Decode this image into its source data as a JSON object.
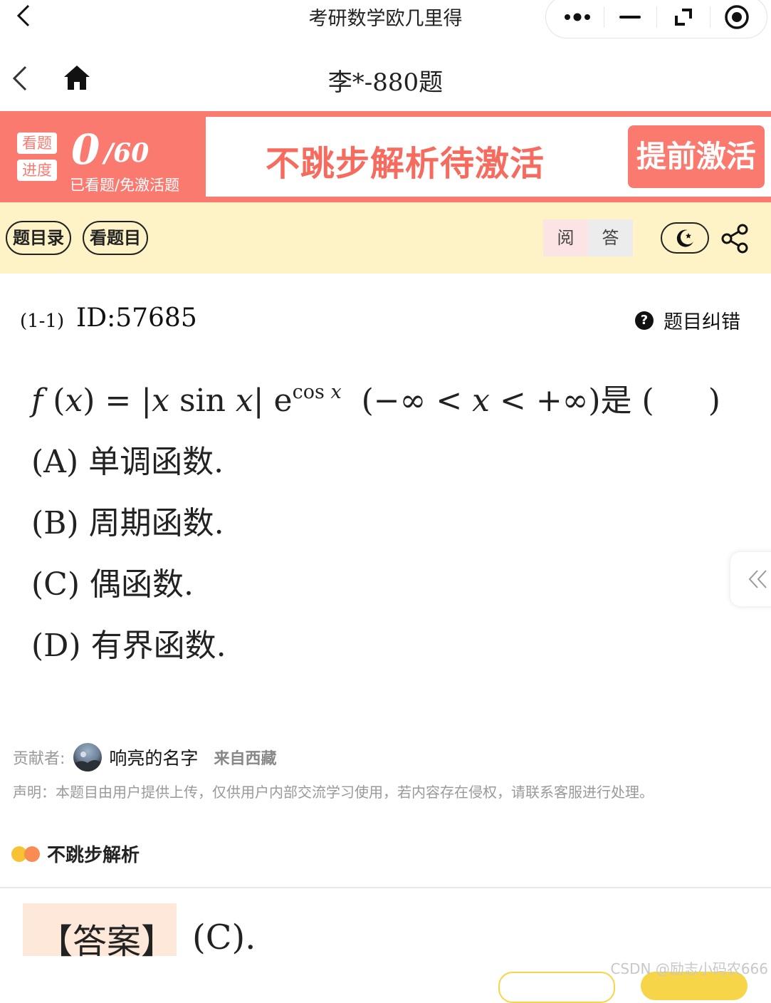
{
  "app": {
    "title": "考研数学欧几里得"
  },
  "capsule": {
    "more": "more-dots-icon",
    "minimize": "minimize-icon",
    "restore": "restore-icon",
    "close": "record-circle-icon"
  },
  "page": {
    "title": "李*-880题"
  },
  "banner": {
    "tag_top": "看题",
    "tag_bottom": "进度",
    "progress": "0",
    "total": "/60",
    "sub": "已看题/免激活题",
    "pending": "不跳步解析待激活",
    "activate": "提前激活"
  },
  "toolbar": {
    "catalog": "题目录",
    "view": "看题目",
    "mode_read": "阅",
    "mode_answer": "答"
  },
  "question": {
    "number": "(1-1)",
    "id": "ID:57685",
    "report": "题目纠错",
    "stem_suffix": "是 (",
    "stem_close": ")",
    "options": [
      {
        "label": "(A)",
        "text": "单调函数."
      },
      {
        "label": "(B)",
        "text": "周期函数."
      },
      {
        "label": "(C)",
        "text": "偶函数."
      },
      {
        "label": "(D)",
        "text": "有界函数."
      }
    ]
  },
  "meta": {
    "contributor_label": "贡献者:",
    "contributor_name": "响亮的名字",
    "source": "来自西藏",
    "notice": "声明：本题目由用户提供上传，仅供用户内部交流学习使用，若内容存在侵权，请联系客服进行处理。"
  },
  "analysis": {
    "label": "不跳步解析",
    "answer_label": "【答案】",
    "answer_value": "(C)."
  },
  "watermark": "CSDN @励志小码农666",
  "colors": {
    "accent": "#fb7a70",
    "toolbar_bg": "#fef3c6",
    "answer_bg": "#fde8d9"
  }
}
